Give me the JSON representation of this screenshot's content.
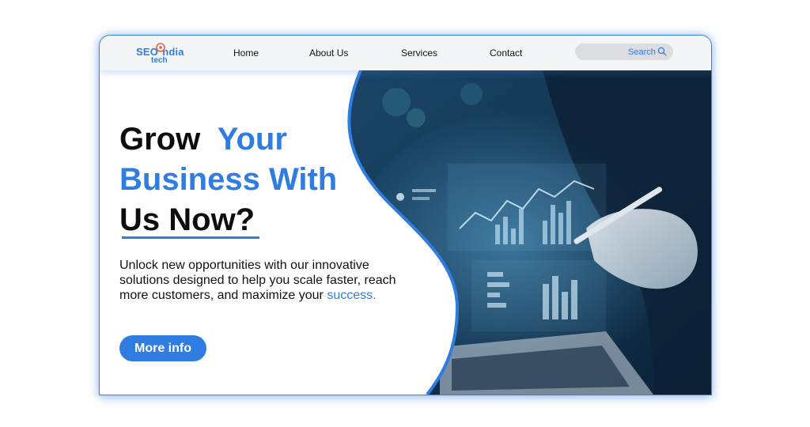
{
  "logo": {
    "line1": "SEO",
    "line1b": "ndia",
    "line2": "tech"
  },
  "nav": {
    "items": [
      {
        "label": "Home"
      },
      {
        "label": "About Us"
      },
      {
        "label": "Services"
      },
      {
        "label": "Contact"
      }
    ]
  },
  "search": {
    "label": "Search",
    "value": ""
  },
  "hero": {
    "headline_1": "Grow",
    "headline_2": "Your",
    "headline_3": "Business With",
    "headline_4": "Us Now?",
    "description": "Unlock new opportunities with our innovative solutions designed to help you scale faster, reach more customers, and maximize your",
    "description_highlight": "success.",
    "cta_label": "More info"
  },
  "colors": {
    "accent": "#2f7de1",
    "text": "#111111",
    "nav_bg": "#f4f5f7",
    "search_bg": "#dcdde1",
    "image_dark": "#0f2a44"
  }
}
